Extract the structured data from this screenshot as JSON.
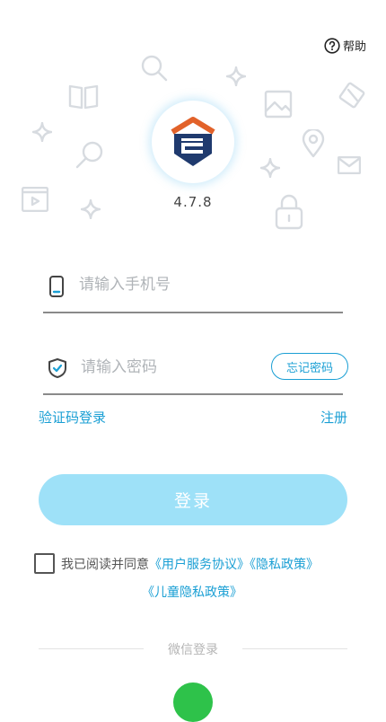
{
  "header": {
    "help_label": "帮助"
  },
  "app": {
    "version": "4.7.8",
    "accent_color": "#1a9fd4",
    "logo_color_primary": "#1f3a6e",
    "logo_color_secondary": "#e2622a"
  },
  "login": {
    "phone_placeholder": "请输入手机号",
    "password_placeholder": "请输入密码",
    "forgot_label": "忘记密码",
    "sms_login_label": "验证码登录",
    "register_label": "注册",
    "submit_label": "登录"
  },
  "agreement": {
    "prefix": "我已阅读并同意",
    "user_agreement": "《用户服务协议》",
    "privacy_policy": "《隐私政策》",
    "children_privacy": "《儿童隐私政策》"
  },
  "third_party": {
    "wechat_label": "微信登录"
  },
  "icons": {
    "help": "question-circle-icon",
    "phone": "phone-icon",
    "shield": "shield-check-icon",
    "wechat": "wechat-icon"
  }
}
